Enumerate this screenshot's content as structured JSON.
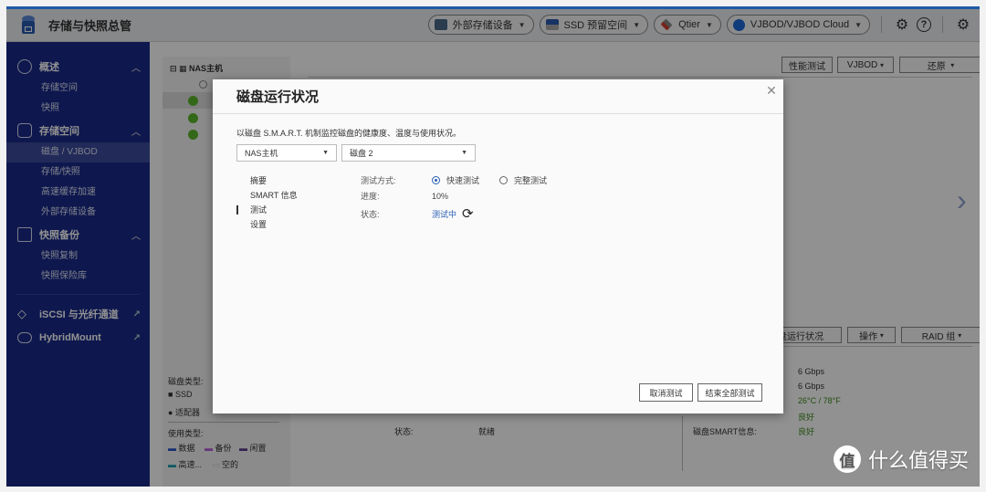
{
  "app": {
    "title": "存储与快照总管"
  },
  "toolbar": {
    "pills": [
      {
        "label": "外部存储设备",
        "icon": "external-storage-icon"
      },
      {
        "label": "SSD 预留空间",
        "icon": "ssd-overprovision-icon"
      },
      {
        "label": "Qtier",
        "icon": "qtier-icon"
      },
      {
        "label": "VJBOD/VJBOD Cloud",
        "icon": "vjbod-cloud-icon"
      }
    ],
    "icons": [
      "debug-icon",
      "help-icon",
      "settings-icon"
    ]
  },
  "sidebar": {
    "groups": [
      {
        "label": "概述",
        "icon": "dashboard-icon",
        "items": [
          "存储空间",
          "快照"
        ]
      },
      {
        "label": "存储空间",
        "icon": "database-icon",
        "items": [
          "磁盘 / VJBOD",
          "存储/快照",
          "高速缓存加速",
          "外部存储设备"
        ],
        "active": 0
      },
      {
        "label": "快照备份",
        "icon": "snapshot-icon",
        "items": [
          "快照复制",
          "快照保险库"
        ]
      }
    ],
    "links": [
      {
        "label": "iSCSI 与光纤通道",
        "icon": "iscsi-icon"
      },
      {
        "label": "HybridMount",
        "icon": "cloud-icon"
      }
    ]
  },
  "background": {
    "tree_root": "NAS主机",
    "top_buttons": {
      "perf": "性能测试",
      "vjbod": "VJBOD",
      "restore": "还原"
    },
    "mid_buttons": {
      "health": "磁盘运行状况",
      "ops": "操作",
      "raid": "RAID 组"
    },
    "legend": {
      "disk_type_label": "磁盘类型:",
      "disk_types": [
        "SSD",
        "适配器"
      ],
      "usage_label": "使用类型:",
      "usage_types": [
        {
          "label": "数据",
          "color": "#2a55c8"
        },
        {
          "label": "备份",
          "color": "#b65ad6"
        },
        {
          "label": "闲置",
          "color": "#5a3a8a"
        },
        {
          "label": "高速...",
          "color": "#1a9aa8"
        },
        {
          "label": "空的",
          "color": "#ffffff"
        }
      ]
    },
    "details": {
      "status_label": "状态:",
      "status_value": "就绪",
      "smart_label": "磁盘SMART信息:",
      "values": [
        "6 Gbps",
        "6 Gbps",
        "26°C / 78°F",
        "良好",
        "良好"
      ]
    }
  },
  "modal": {
    "title": "磁盘运行状况",
    "description": "以磁盘 S.M.A.R.T. 机制监控磁盘的健康度、温度与使用状况。",
    "host_select": "NAS主机",
    "disk_select": "磁盘 2",
    "tabs": [
      "摘要",
      "SMART 信息",
      "测试",
      "设置"
    ],
    "active_tab": 2,
    "test_mode_label": "测试方式:",
    "test_modes": [
      "快速测试",
      "完整测试"
    ],
    "progress_label": "进度:",
    "progress_value": "10%",
    "status_label": "状态:",
    "status_value": "测试中",
    "buttons": {
      "cancel": "取消测试",
      "end_all": "结束全部测试"
    }
  },
  "watermark": {
    "logo": "值",
    "text": "什么值得买"
  }
}
